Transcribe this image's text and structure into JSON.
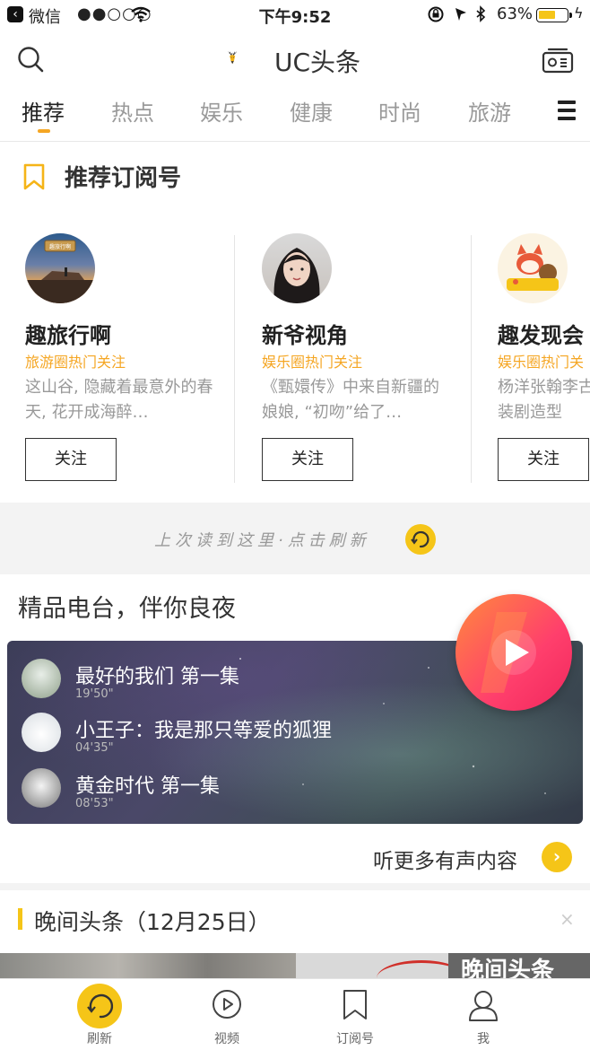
{
  "status_bar": {
    "back_app": "微信",
    "signal": "●●○○○",
    "time": "下午9:52",
    "battery_pct": "63%",
    "battery_level": 0.63
  },
  "header": {
    "logo_text": "UC头条"
  },
  "tabs": [
    {
      "label": "推荐",
      "active": true
    },
    {
      "label": "热点"
    },
    {
      "label": "娱乐"
    },
    {
      "label": "健康"
    },
    {
      "label": "时尚"
    },
    {
      "label": "旅游"
    }
  ],
  "recommend": {
    "title": "推荐订阅号",
    "cards": [
      {
        "name": "趣旅行啊",
        "tag": "旅游圈热门关注",
        "desc": "这山谷, 隐藏着最意外的春天, 花开成海醉…",
        "follow": "关注",
        "avatar_badge": "趣旅行啊"
      },
      {
        "name": "新爷视角",
        "tag": "娱乐圈热门关注",
        "desc": "《甄嬛传》中来自新疆的娘娘, “初吻”给了…",
        "follow": "关注"
      },
      {
        "name": "趣发现会",
        "tag": "娱乐圈热门关",
        "desc": "杨洋张翰李古装剧造型",
        "follow": "关注"
      }
    ]
  },
  "refresh_banner": "上次读到这里·点击刷新",
  "radio": {
    "title": "精品电台，伴你良夜",
    "items": [
      {
        "title": "最好的我们 第一集",
        "duration": "19'50\""
      },
      {
        "title": "小王子：我是那只等爱的狐狸",
        "duration": "04'35\""
      },
      {
        "title": "黄金时代 第一集",
        "duration": "08'53\""
      }
    ],
    "more": "听更多有声内容"
  },
  "evening": {
    "title": "晚间头条（12月25日）",
    "close": "×",
    "image_text": "晚间头条"
  },
  "bottom_nav": [
    {
      "label": "刷新",
      "icon": "refresh-icon"
    },
    {
      "label": "视频",
      "icon": "video-icon"
    },
    {
      "label": "订阅号",
      "icon": "bookmark-icon"
    },
    {
      "label": "我",
      "icon": "user-icon"
    }
  ],
  "colors": {
    "accent": "#f5c518",
    "accent_text": "#f5a623",
    "play": "#ff3f6c"
  }
}
